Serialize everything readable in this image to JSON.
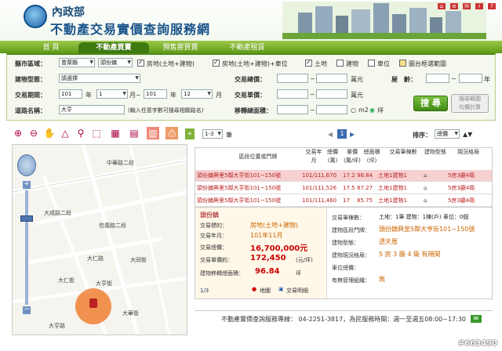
{
  "header": {
    "org_name": "內政部",
    "site_title": "不動產交易實價查詢服務網",
    "icons": [
      "home-icon",
      "sitemap-icon",
      "email-icon",
      "info-icon",
      "help-icon"
    ]
  },
  "nav": {
    "tabs": [
      {
        "label": "首  頁"
      },
      {
        "label": "不動產買賣"
      },
      {
        "label": "預售屋買賣"
      },
      {
        "label": "不動產租賃"
      }
    ]
  },
  "search": {
    "county_label": "縣市區域：",
    "county_value": "苗栗縣",
    "town_value": "頭份鎮",
    "opt_land_building": "房地(土地+建物)",
    "opt_land_building_parking": "房地(土地+建物)+車位",
    "opt_land": "土地",
    "opt_building": "建物",
    "opt_parking": "車位",
    "opt_draw": "圖台框選範圍",
    "type_label": "建物型態：",
    "type_value": "請選擇",
    "total_price_label": "交易總價：",
    "total_price_unit": "萬元",
    "tilde": "~",
    "age_label": "屋　齡：",
    "age_unit": "年",
    "period_label": "交易期間：",
    "year_from": "101",
    "year_txt": "年",
    "month_from": "1",
    "month_to_txt": "月~",
    "year_to": "101",
    "month_to": "12",
    "month_txt": "月",
    "unit_price_label": "交易單價：",
    "unit_price_unit": "萬元",
    "road_label": "道路名稱：",
    "road_value": "大亨",
    "road_hint": "(輸入任意字數可搜尋相關路名)",
    "area_label": "移轉總面積：",
    "area_unit_m2": "m2",
    "area_unit_ping": "坪",
    "search_button": "搜 尋",
    "calc_button": "搜尋範圍\n均價計算"
  },
  "results": {
    "per_page": "1-3",
    "per_page_unit": "筆",
    "page": "1",
    "sort_label": "排序：",
    "sort_value": "總價",
    "columns": [
      "區段位置或門牌",
      "交易年月",
      "總價(萬)",
      "單價(萬/坪)",
      "總面積(坪)",
      "交易筆棟數",
      "建物型態",
      "現況格局"
    ],
    "rows": [
      {
        "addr": "頭份鎮興里5鄰大亨街101~150號",
        "date": "101/11",
        "total": "1,670",
        "unit": "17.2",
        "area": "96.84",
        "count": "土地1建物1",
        "rooms": "5房3廳4衛"
      },
      {
        "addr": "頭份鎮興里5鄰大亨街101~150號",
        "date": "101/11",
        "total": "1,526",
        "unit": "17.5",
        "area": "87.27",
        "count": "土地1建物1",
        "rooms": "5房3廳4衛"
      },
      {
        "addr": "頭份鎮興里5鄰大亨街101~150號",
        "date": "101/11",
        "total": "1,460",
        "unit": "17",
        "area": "85.75",
        "count": "土地1建物1",
        "rooms": "5房3廳4衛"
      }
    ]
  },
  "detail": {
    "town": "頭份鎮",
    "target_label": "交易標的：",
    "target_value": "房地(土地+建物)",
    "date_label": "交易年月：",
    "date_value": "101年11月",
    "total_label": "交易總價：",
    "total_value": "16,700,000元",
    "unit_label": "交易單價約：",
    "unit_value": "172,450",
    "unit_unit": "(元/坪)",
    "area_label": "建物移轉總面積：",
    "area_value": "96.84",
    "area_unit": "坪",
    "page": "1/3",
    "map_link": "地圖",
    "detail_link": "交易明細",
    "count_label": "交易筆棟數：",
    "count_value": "土地：1筆 建物：1棟(戶) 車位：0個",
    "addr_label": "建物區段門牌：",
    "addr_value": "頭份鎮興里5鄰大亨街101~150號",
    "btype_label": "建物型態：",
    "btype_value": "透天厝",
    "layout_label": "建物現況格局：",
    "layout_value": "5 房 3 廳 4 衛 有隔間",
    "parking_label": "車位總價：",
    "parking_value": "",
    "mgmt_label": "有無管理組織：",
    "mgmt_value": "無"
  },
  "map": {
    "roads": [
      "中華路二段",
      "大成路二段",
      "信義路二段",
      "大仁路",
      "大亨街",
      "大同街",
      "大仁街",
      "大亨路",
      "大華街"
    ]
  },
  "footer": {
    "hotline": "不動產實價查詢服務專線： 04-2251-3817，為民服務時間：週一至週五08:00~17:30"
  },
  "watermark": "#663490"
}
